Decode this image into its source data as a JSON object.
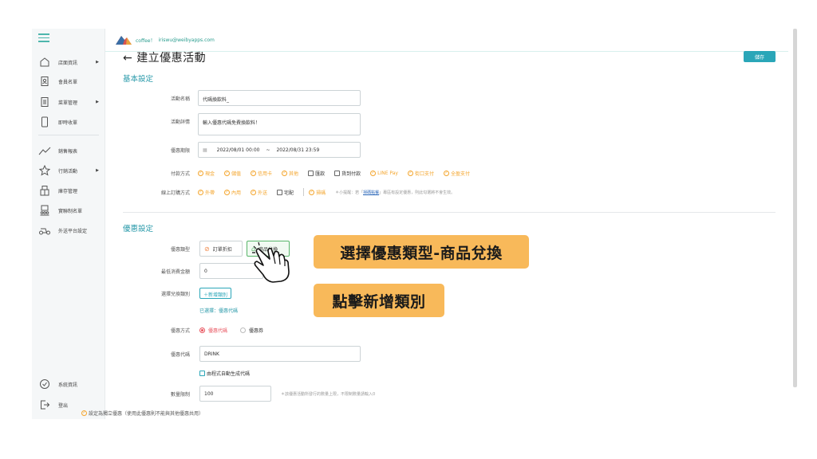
{
  "header": {
    "brand": "coffee！",
    "email": "iriswu@weibyapps.com"
  },
  "sidebar": {
    "items": [
      {
        "label": "店面資訊",
        "icon": "store-icon",
        "has_arrow": true
      },
      {
        "label": "會員名單",
        "icon": "member-icon",
        "has_arrow": false
      },
      {
        "label": "菜單管理",
        "icon": "menu-book-icon",
        "has_arrow": true
      },
      {
        "label": "即時收單",
        "icon": "tablet-icon",
        "has_arrow": false
      },
      {
        "label": "銷售報表",
        "icon": "chart-icon",
        "has_arrow": false
      },
      {
        "label": "行銷活動",
        "icon": "marketing-icon",
        "has_arrow": true
      },
      {
        "label": "庫存管理",
        "icon": "inventory-icon",
        "has_arrow": false
      },
      {
        "label": "實聯制名單",
        "icon": "register-icon",
        "has_arrow": false
      },
      {
        "label": "外送平台設定",
        "icon": "delivery-icon",
        "has_arrow": false
      }
    ],
    "bottom": [
      {
        "label": "系統資訊",
        "icon": "shield-check-icon"
      },
      {
        "label": "登出",
        "icon": "logout-icon"
      }
    ]
  },
  "page": {
    "back_arrow": "←",
    "title": "建立優惠活動",
    "save_label": "儲存"
  },
  "basic": {
    "section_title": "基本設定",
    "name_label": "活動名稱",
    "name_value": "代碼換飲料_",
    "detail_label": "活動詳情",
    "detail_value": "輸入優惠代碼免費換飲料！",
    "period_label": "優惠期限",
    "period_start": "2022/08/01 00:00",
    "period_sep": "~",
    "period_end": "2022/08/31 23:59",
    "payment_label": "付款方式",
    "payments": [
      {
        "label": "現金",
        "checked": true
      },
      {
        "label": "儲值",
        "checked": true
      },
      {
        "label": "信用卡",
        "checked": true
      },
      {
        "label": "其他",
        "checked": true
      },
      {
        "label": "匯款",
        "checked": false
      },
      {
        "label": "貨到付款",
        "checked": false
      },
      {
        "label": "LINE Pay",
        "checked": true
      },
      {
        "label": "街口支付",
        "checked": true
      },
      {
        "label": "全盈支付",
        "checked": true
      }
    ],
    "order_label": "線上訂購方式",
    "orders": [
      {
        "label": "外帶",
        "checked": true
      },
      {
        "label": "內用",
        "checked": true
      },
      {
        "label": "外送",
        "checked": true
      },
      {
        "label": "宅配",
        "checked": false
      }
    ],
    "extra_order": {
      "label": "掃碼",
      "checked": true
    },
    "order_hint_pre": "＊小提醒：若「",
    "order_hint_link": "掃碼點餐",
    "order_hint_post": "」專區有設定優惠，則此勾選將不會生效。"
  },
  "discount": {
    "section_title": "優惠設定",
    "type_label": "優惠類型",
    "type_order": "訂單折扣",
    "type_product": "商品兌換",
    "min_label": "最低消費金額",
    "min_value": "0",
    "min_unit": "元",
    "category_label": "選擇兌換類別",
    "add_category": "＋新增類別",
    "selected_text": "已選擇：優惠代碼",
    "method_label": "優惠方式",
    "method_code": "優惠代碼",
    "method_coupon": "優惠券",
    "code_label": "優惠代碼",
    "code_value": "DRINK",
    "auto_gen": "由程式自動生成代碼",
    "limit_label": "數量限制",
    "limit_value": "100",
    "limit_hint": "＊該優惠活動所發行的數量上限，不限制數量請輸入0",
    "standalone": "設定為獨立優惠（使用此優惠則不能與其他優惠共用）"
  },
  "callouts": {
    "first": "選擇優惠類型-商品兌換",
    "second": "點擊新增類別"
  },
  "colors": {
    "accent": "#2aa6b8",
    "checked": "#f4a52c",
    "callout_bg": "#f8b95a",
    "radio_on": "#e8505b"
  }
}
